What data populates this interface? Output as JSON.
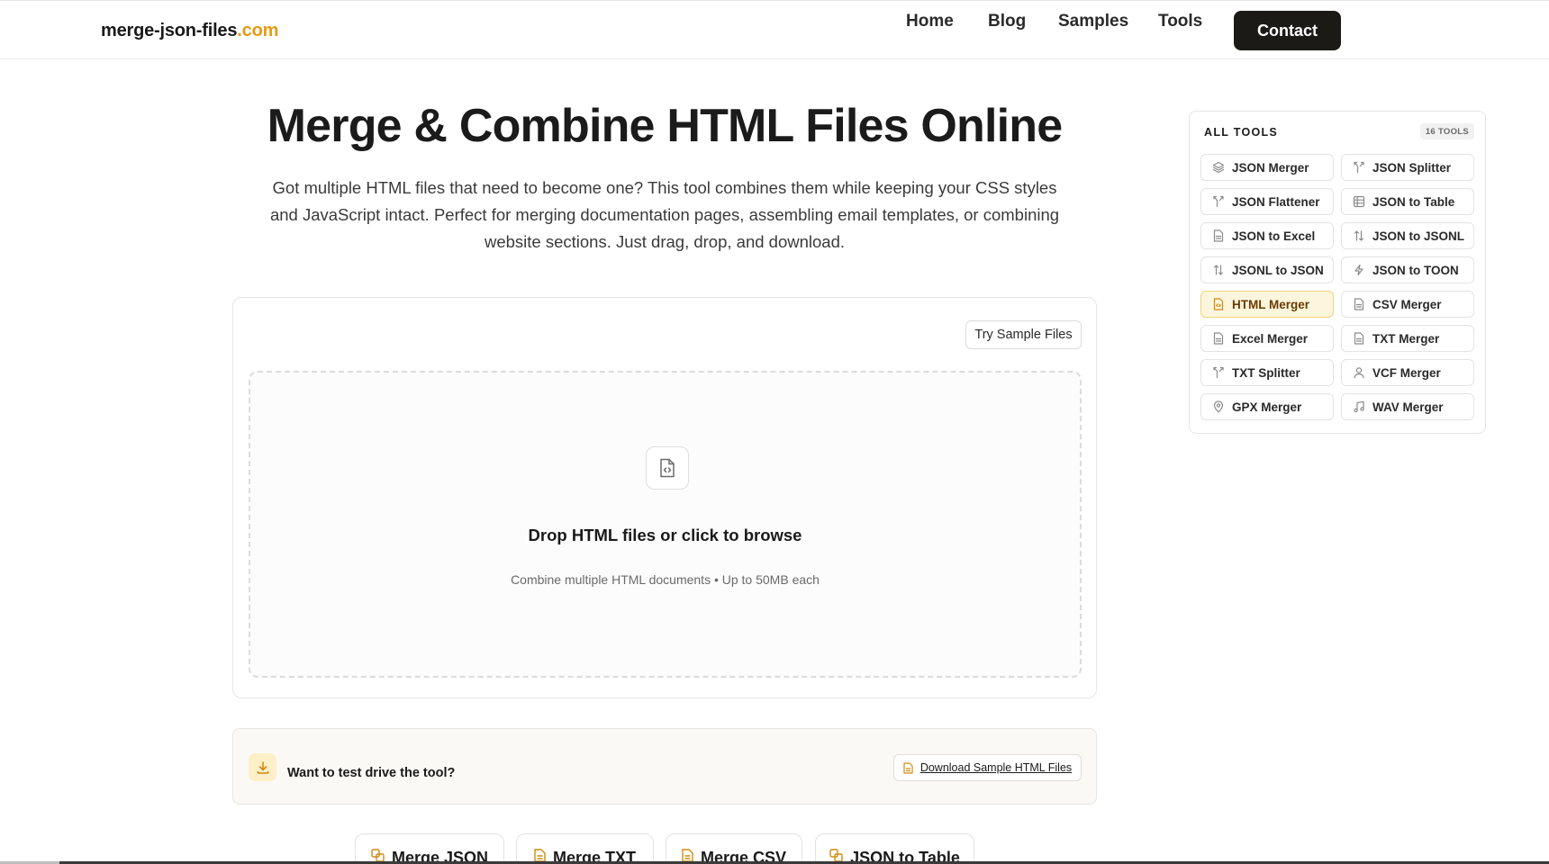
{
  "header": {
    "logo_main": "merge-json-files",
    "logo_tld": ".com",
    "nav": [
      "Home",
      "Blog",
      "Samples",
      "Tools"
    ],
    "contact": "Contact"
  },
  "hero": {
    "title": "Merge & Combine HTML Files Online",
    "description": "Got multiple HTML files that need to become one? This tool combines them while keeping your CSS styles and JavaScript intact. Perfect for merging documentation pages, assembling email templates, or combining website sections. Just drag, drop, and download."
  },
  "upload": {
    "sample_button": "Try Sample Files",
    "drop_title": "Drop HTML files or click to browse",
    "drop_sub": "Combine multiple HTML documents • Up to 50MB each",
    "icon": "file-code-icon"
  },
  "test_drive": {
    "text": "Want to test drive the tool?",
    "download": "Download Sample HTML Files",
    "icon": "download-icon"
  },
  "related": [
    "Merge JSON",
    "Merge TXT",
    "Merge CSV",
    "JSON to Table"
  ],
  "sidebar": {
    "title": "ALL TOOLS",
    "count": "16 TOOLS",
    "items": [
      {
        "label": "JSON Merger",
        "icon": "layers-icon"
      },
      {
        "label": "JSON Splitter",
        "icon": "split-icon"
      },
      {
        "label": "JSON Flattener",
        "icon": "split-icon"
      },
      {
        "label": "JSON to Table",
        "icon": "table-icon"
      },
      {
        "label": "JSON to Excel",
        "icon": "file-icon"
      },
      {
        "label": "JSON to JSONL",
        "icon": "arrows-updown-icon"
      },
      {
        "label": "JSONL to JSON",
        "icon": "arrows-updown-icon"
      },
      {
        "label": "JSON to TOON",
        "icon": "bolt-icon"
      },
      {
        "label": "HTML Merger",
        "icon": "file-code-icon",
        "active": true
      },
      {
        "label": "CSV Merger",
        "icon": "file-icon"
      },
      {
        "label": "Excel Merger",
        "icon": "file-icon"
      },
      {
        "label": "TXT Merger",
        "icon": "file-icon"
      },
      {
        "label": "TXT Splitter",
        "icon": "split-icon"
      },
      {
        "label": "VCF Merger",
        "icon": "user-icon"
      },
      {
        "label": "GPX Merger",
        "icon": "pin-icon"
      },
      {
        "label": "WAV Merger",
        "icon": "music-icon"
      }
    ]
  },
  "colors": {
    "accent": "#e89a14",
    "dark_button": "#1c1a17",
    "active_bg": "#fdf6dd",
    "active_border": "#f0d27a"
  }
}
